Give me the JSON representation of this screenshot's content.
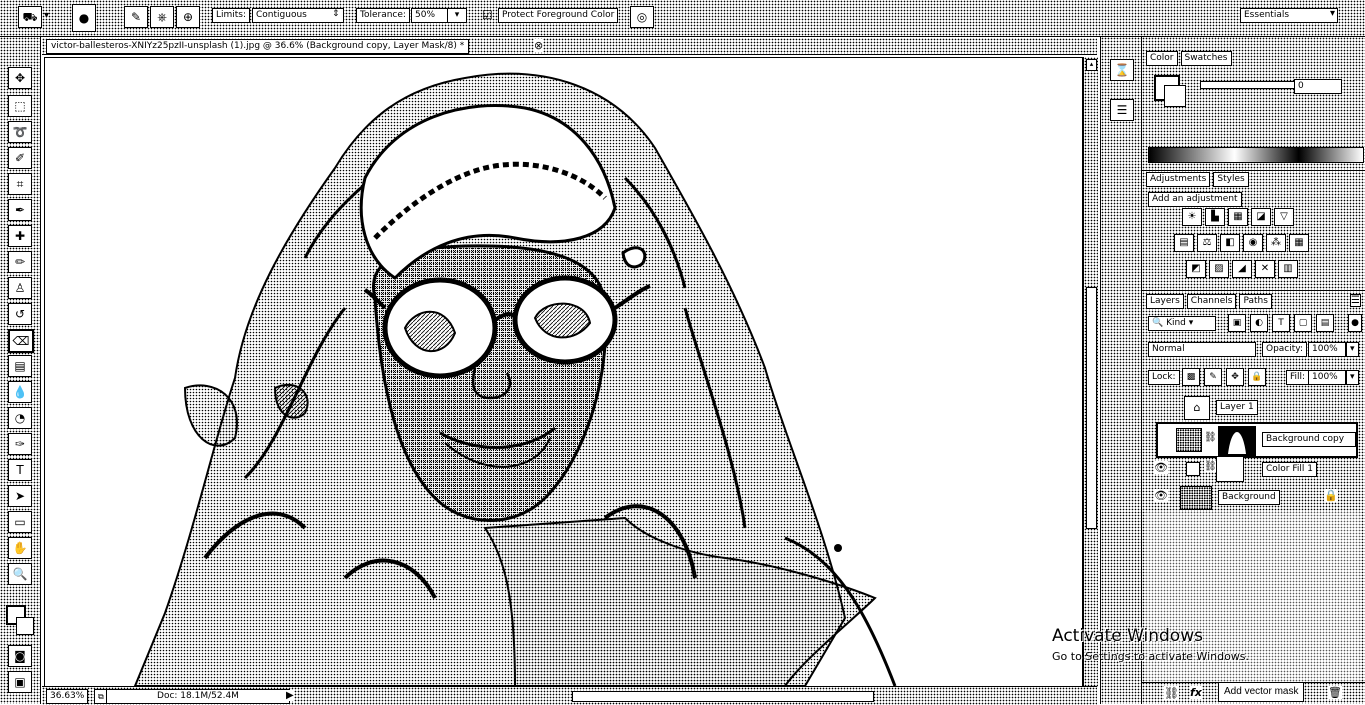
{
  "options_bar": {
    "limits_label": "Limits:",
    "limits_value": "Contiguous",
    "tolerance_label": "Tolerance:",
    "tolerance_value": "50%",
    "protect_label": "Protect Foreground Color",
    "workspace": "Essentials"
  },
  "document": {
    "tab_title": "victor-ballesteros-XNIYz25pzII-unsplash (1).jpg @ 36.6% (Background copy, Layer Mask/8) *",
    "zoom": "36.63%",
    "doc_size": "Doc: 18.1M/52.4M"
  },
  "color_panel": {
    "tabs": [
      "Color",
      "Swatches"
    ],
    "value": "0"
  },
  "adjustments_panel": {
    "tabs": [
      "Adjustments",
      "Styles"
    ],
    "heading": "Add an adjustment"
  },
  "layers_panel": {
    "tabs": [
      "Layers",
      "Channels",
      "Paths"
    ],
    "filter": "Kind",
    "blend_mode": "Normal",
    "opacity_label": "Opacity:",
    "opacity_value": "100%",
    "lock_label": "Lock:",
    "fill_label": "Fill:",
    "fill_value": "100%",
    "layers": [
      {
        "name": "Layer 1"
      },
      {
        "name": "Background copy"
      },
      {
        "name": "Color Fill 1"
      },
      {
        "name": "Background"
      }
    ]
  },
  "watermark": {
    "title": "Activate Windows",
    "subtitle": "Go to Settings to activate Windows."
  },
  "tooltip": "Add vector mask",
  "icons": [
    "paint-bucket-icon",
    "move-icon",
    "marquee-icon",
    "lasso-icon",
    "quick-select-icon",
    "crop-icon",
    "eyedropper-icon",
    "healing-icon",
    "brush-icon",
    "stamp-icon",
    "history-brush-icon",
    "eraser-icon",
    "gradient-icon",
    "blur-icon",
    "dodge-icon",
    "pen-icon",
    "type-icon",
    "path-select-icon",
    "shape-icon",
    "hand-icon",
    "zoom-icon",
    "eye-icon",
    "lock-icon",
    "link-icon",
    "fx-icon",
    "trash-icon"
  ]
}
